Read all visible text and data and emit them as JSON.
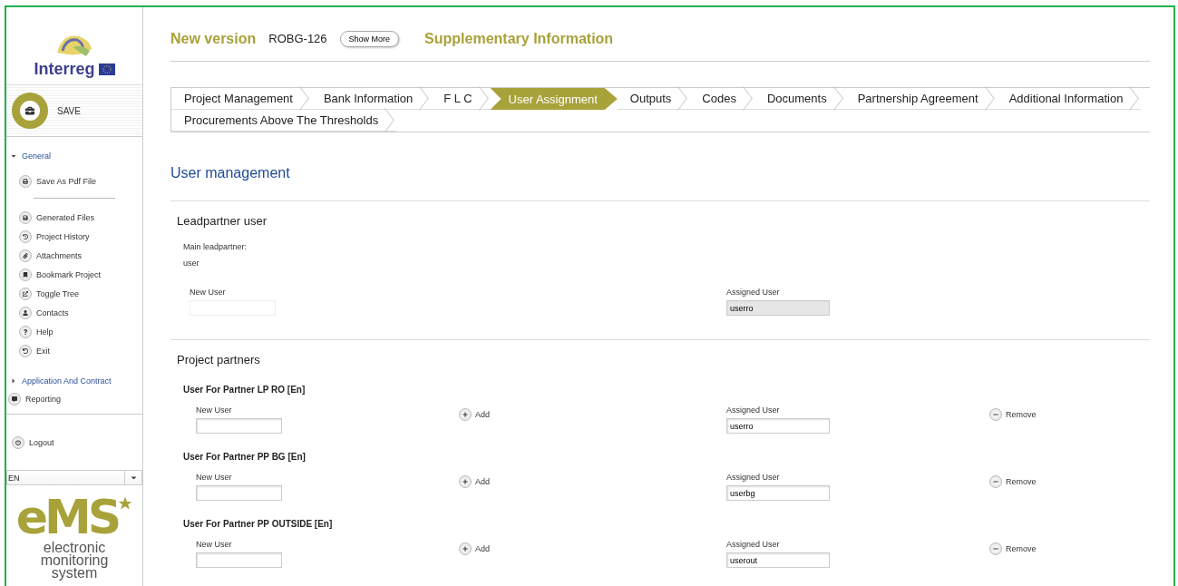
{
  "logo": {
    "name": "Interreg"
  },
  "save": {
    "label": "SAVE"
  },
  "sidebar": {
    "nav": [
      {
        "kind": "group",
        "label": "General",
        "expanded": true,
        "children": [
          {
            "kind": "item",
            "label": "Save As Pdf File"
          },
          {
            "kind": "divider"
          },
          {
            "kind": "item",
            "label": "Generated Files"
          },
          {
            "kind": "item",
            "label": "Project History"
          },
          {
            "kind": "item",
            "label": "Attachments"
          },
          {
            "kind": "item",
            "label": "Bookmark Project"
          },
          {
            "kind": "item",
            "label": "Toggle Tree"
          },
          {
            "kind": "item",
            "label": "Contacts"
          },
          {
            "kind": "item",
            "label": "Help"
          },
          {
            "kind": "item",
            "label": "Exit"
          }
        ]
      },
      {
        "kind": "group",
        "label": "Application And Contract",
        "expanded": false
      },
      {
        "kind": "link",
        "label": "Reporting"
      }
    ],
    "logout": "Logout",
    "language": "EN",
    "brand": {
      "name": "eMS",
      "tagline": "electronic monitoring system"
    }
  },
  "header": {
    "title": "New version",
    "code": "ROBG-126",
    "button": "Show More",
    "section": "Supplementary Information"
  },
  "tabs": [
    {
      "label": "Project Management",
      "selected": false
    },
    {
      "label": "Bank Information",
      "selected": false
    },
    {
      "label": "F L C",
      "selected": false
    },
    {
      "label": "User Assignment",
      "selected": true
    },
    {
      "label": "Outputs",
      "selected": false
    },
    {
      "label": "Codes",
      "selected": false
    },
    {
      "label": "Documents",
      "selected": false
    },
    {
      "label": "Partnership Agreement",
      "selected": false
    },
    {
      "label": "Additional Information",
      "selected": false
    },
    {
      "label": "Procurements Above The Thresholds",
      "selected": false
    }
  ],
  "page_title": "User management",
  "leadpartner": {
    "heading": "Leadpartner user",
    "main_label": "Main leadpartner:",
    "main_value": "user",
    "new_user_label": "New User",
    "assigned_label": "Assigned User",
    "assigned_value": "userro",
    "readonly": true
  },
  "partners": {
    "heading": "Project partners",
    "items": [
      {
        "title": "User For Partner LP RO [En]",
        "new_user_label": "New User",
        "add": "Add",
        "assigned_label": "Assigned User",
        "assigned_value": "userro",
        "remove": "Remove"
      },
      {
        "title": "User For Partner PP BG [En]",
        "new_user_label": "New User",
        "add": "Add",
        "assigned_label": "Assigned User",
        "assigned_value": "userbg",
        "remove": "Remove"
      },
      {
        "title": "User For Partner PP OUTSIDE [En]",
        "new_user_label": "New User",
        "add": "Add",
        "assigned_label": "Assigned User",
        "assigned_value": "userout",
        "remove": "Remove"
      }
    ]
  }
}
